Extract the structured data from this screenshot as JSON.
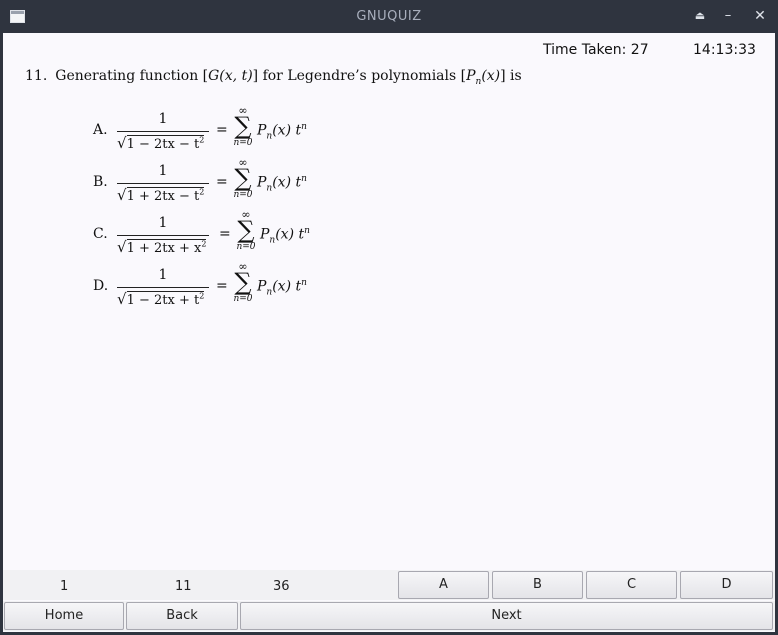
{
  "window": {
    "title": "GNUQUIZ",
    "controls": {
      "eject": "⏏",
      "minimize": "–",
      "close": "✕"
    }
  },
  "header": {
    "time_taken_label": "Time Taken: 27",
    "clock": "14:13:33"
  },
  "question": {
    "number": "11.",
    "text_1": "Generating function [",
    "gxt": "G(x, t)",
    "text_2": "] for Legendre’s polynomials [",
    "pnx": "P",
    "pnx_sub": "n",
    "pnx_arg": "(x)",
    "text_3": "] is"
  },
  "options": [
    {
      "letter": "A.",
      "numerator": "1",
      "radicand": "1 − 2tx − t",
      "radicand_sup": "2",
      "equals": "=",
      "sum_upper": "∞",
      "sum_sign": "∑",
      "sum_lower": "n=0",
      "term_p": "P",
      "term_sub": "n",
      "term_arg": "(x) t",
      "term_sup": "n"
    },
    {
      "letter": "B.",
      "numerator": "1",
      "radicand": "1 + 2tx − t",
      "radicand_sup": "2",
      "equals": "=",
      "sum_upper": "∞",
      "sum_sign": "∑",
      "sum_lower": "n=0",
      "term_p": "P",
      "term_sub": "n",
      "term_arg": "(x) t",
      "term_sup": "n"
    },
    {
      "letter": "C.",
      "numerator": "1",
      "radicand": "1 + 2tx + x",
      "radicand_sup": "2",
      "equals": "=",
      "sum_upper": "∞",
      "sum_sign": "∑",
      "sum_lower": "n=0",
      "term_p": "P",
      "term_sub": "n",
      "term_arg": "(x) t",
      "term_sup": "n"
    },
    {
      "letter": "D.",
      "numerator": "1",
      "radicand": "1 − 2tx + t",
      "radicand_sup": "2",
      "equals": "=",
      "sum_upper": "∞",
      "sum_sign": "∑",
      "sum_lower": "n=0",
      "term_p": "P",
      "term_sub": "n",
      "term_arg": "(x) t",
      "term_sup": "n"
    }
  ],
  "status": {
    "current": "1",
    "question_no": "11",
    "total": "36"
  },
  "answers": {
    "a": "A",
    "b": "B",
    "c": "C",
    "d": "D"
  },
  "nav": {
    "home": "Home",
    "back": "Back",
    "next": "Next"
  }
}
